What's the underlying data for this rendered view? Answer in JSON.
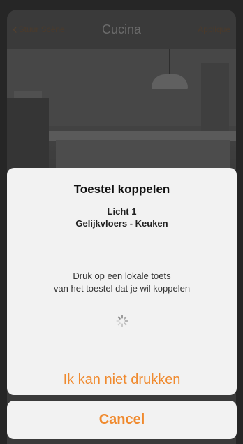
{
  "navbar": {
    "back_label": "Stuur Scène",
    "title": "Cucina",
    "apply_label": "Applique"
  },
  "dialog": {
    "title": "Toestel koppelen",
    "device_name": "Licht 1",
    "device_location": "Gelijkvloers - Keuken",
    "instruction_line1": "Druk op een lokale toets",
    "instruction_line2": "van het toestel dat je wil koppelen",
    "action_label": "Ik kan niet drukken"
  },
  "cancel_label": "Cancel",
  "colors": {
    "accent": "#f08a2e",
    "dialog_bg": "#f2f2f2"
  },
  "icons": {
    "back": "chevron-left-icon",
    "spinner": "loading-spinner-icon"
  }
}
